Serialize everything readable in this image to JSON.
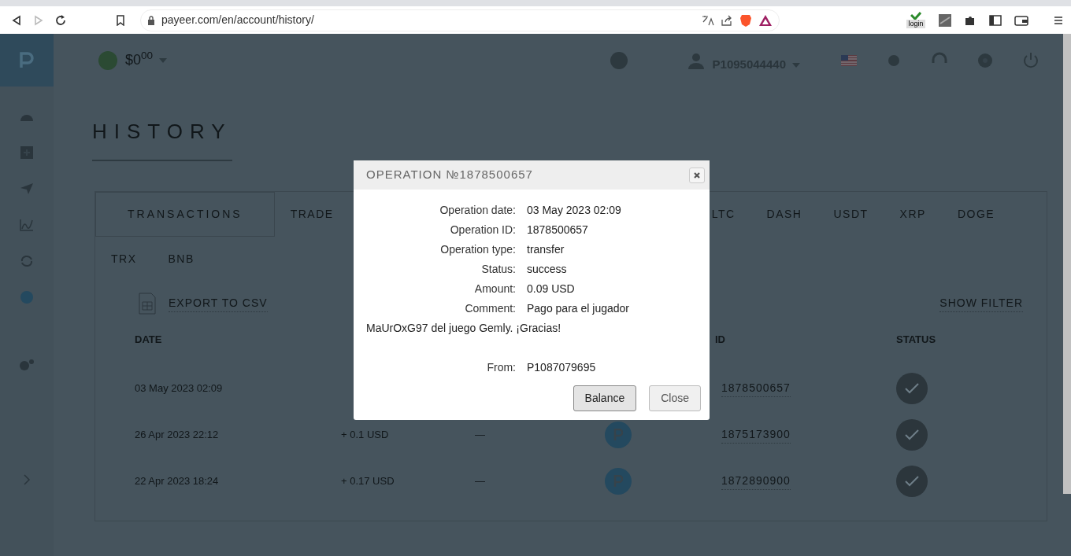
{
  "browser": {
    "url": "payeer.com/en/account/history/",
    "extension_label": "login"
  },
  "header": {
    "balance": "$0$^{00}$",
    "account": "P1095044440"
  },
  "page_title": "HISTORY",
  "tabs": [
    {
      "label": "TRANSACTIONS",
      "selected": true
    },
    {
      "label": "TRADE",
      "selected": false
    },
    {
      "label": "LTC",
      "selected": false
    },
    {
      "label": "DASH",
      "selected": false
    },
    {
      "label": "USDT",
      "selected": false
    },
    {
      "label": "XRP",
      "selected": false
    },
    {
      "label": "DOGE",
      "selected": false
    },
    {
      "label": "TRX",
      "selected": false
    },
    {
      "label": "BNB",
      "selected": false
    }
  ],
  "export_label": "EXPORT TO CSV",
  "filter_label": "SHOW FILTER",
  "table": {
    "columns": [
      "DATE",
      "ID",
      "STATUS"
    ],
    "rows": [
      {
        "date": "03 May 2023 02:09",
        "id": "1878500657"
      },
      {
        "date": "26 Apr 2023 22:12",
        "amount": "+ 0.1 USD",
        "comment": "—",
        "id": "1875173900"
      },
      {
        "date": "22 Apr 2023 18:24",
        "amount": "+ 0.17 USD",
        "comment": "—",
        "id": "1872890900"
      }
    ]
  },
  "dialog": {
    "title": "OPERATION №1878500657",
    "fields": [
      {
        "label": "Operation date:",
        "value": "03 May 2023 02:09"
      },
      {
        "label": "Operation ID:",
        "value": "1878500657"
      },
      {
        "label": "Operation type:",
        "value": "transfer"
      },
      {
        "label": "Status:",
        "value": "success"
      },
      {
        "label": "Amount:",
        "value": "0.09 USD"
      },
      {
        "label": "Comment:",
        "value": "Pago para el jugador",
        "continuation": "MaUrOxG97 del juego Gemly. ¡Gracias!"
      },
      {
        "label": "From:",
        "value": "P1087079695"
      }
    ],
    "buttons": [
      {
        "label": "Balance",
        "selected": true
      },
      {
        "label": "Close",
        "selected": false
      }
    ]
  }
}
